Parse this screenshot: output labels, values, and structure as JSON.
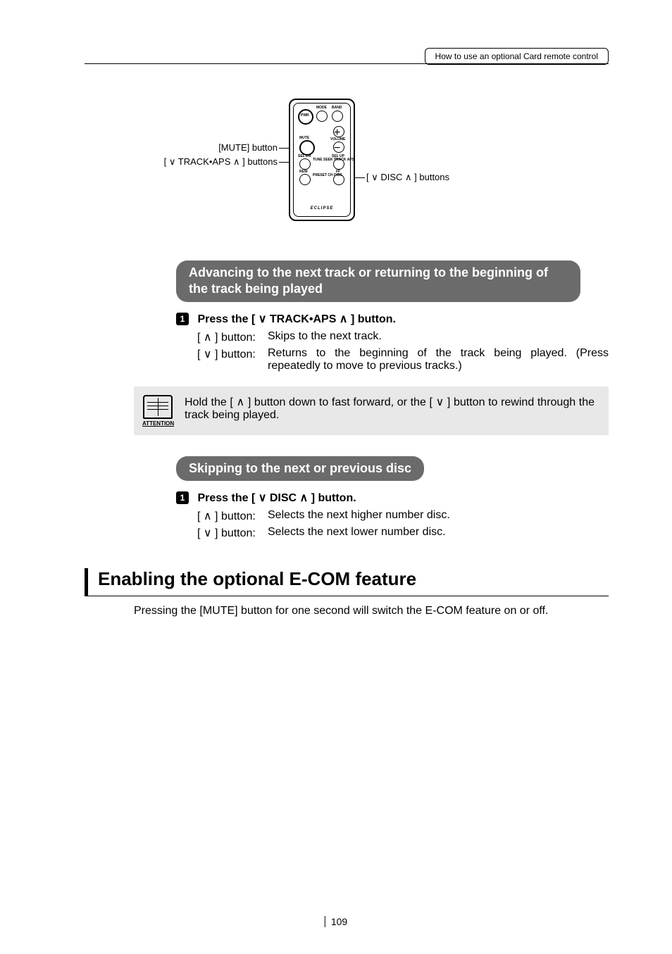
{
  "header": {
    "tab": "How to use an optional Card remote control"
  },
  "diagram": {
    "labels": {
      "mute": "[MUTE] button",
      "track": "[ ∨ TRACK•APS ∧ ] buttons",
      "disc": "[ ∨ DISC ∧ ] buttons"
    },
    "remote": {
      "pwr": "PWR",
      "mode": "MODE",
      "band": "BAND",
      "volume": "VOLUME",
      "mute": "MUTE",
      "tune_seek": "TUNE SEEK\nTRACK APS",
      "preset_ch": "PRESET CH\nDISC",
      "sel_up": "SEL UP",
      "sel_dn": "SEL DN",
      "rew": "REW",
      "ff": "FF",
      "logo": "ECLIPSE"
    }
  },
  "sections": {
    "s1": {
      "title": "Advancing to the next track or returning to the beginning of the track being played",
      "step_label": "Press the [ ∨ TRACK•APS ∧ ] button.",
      "rows": [
        {
          "key": "[ ∧ ] button:",
          "val": "Skips to the next track."
        },
        {
          "key": "[ ∨ ] button:",
          "val": "Returns to the beginning of the track being played. (Press repeatedly to move to previous tracks.)"
        }
      ]
    },
    "attention": {
      "label": "ATTENTION",
      "text": "Hold the [ ∧ ] button down to fast forward, or the [ ∨ ] button to rewind through the track being played."
    },
    "s2": {
      "title": "Skipping to the next or previous disc",
      "step_label": "Press the [ ∨ DISC ∧ ] button.",
      "rows": [
        {
          "key": "[ ∧ ] button:",
          "val": "Selects the next higher number disc."
        },
        {
          "key": "[ ∨ ] button:",
          "val": "Selects the next lower number disc."
        }
      ]
    },
    "s3": {
      "title": "Enabling the optional E-COM feature",
      "body": "Pressing the [MUTE] button for one second will switch the E-COM feature on or off."
    }
  },
  "page_number": "109",
  "step_badge": "1"
}
